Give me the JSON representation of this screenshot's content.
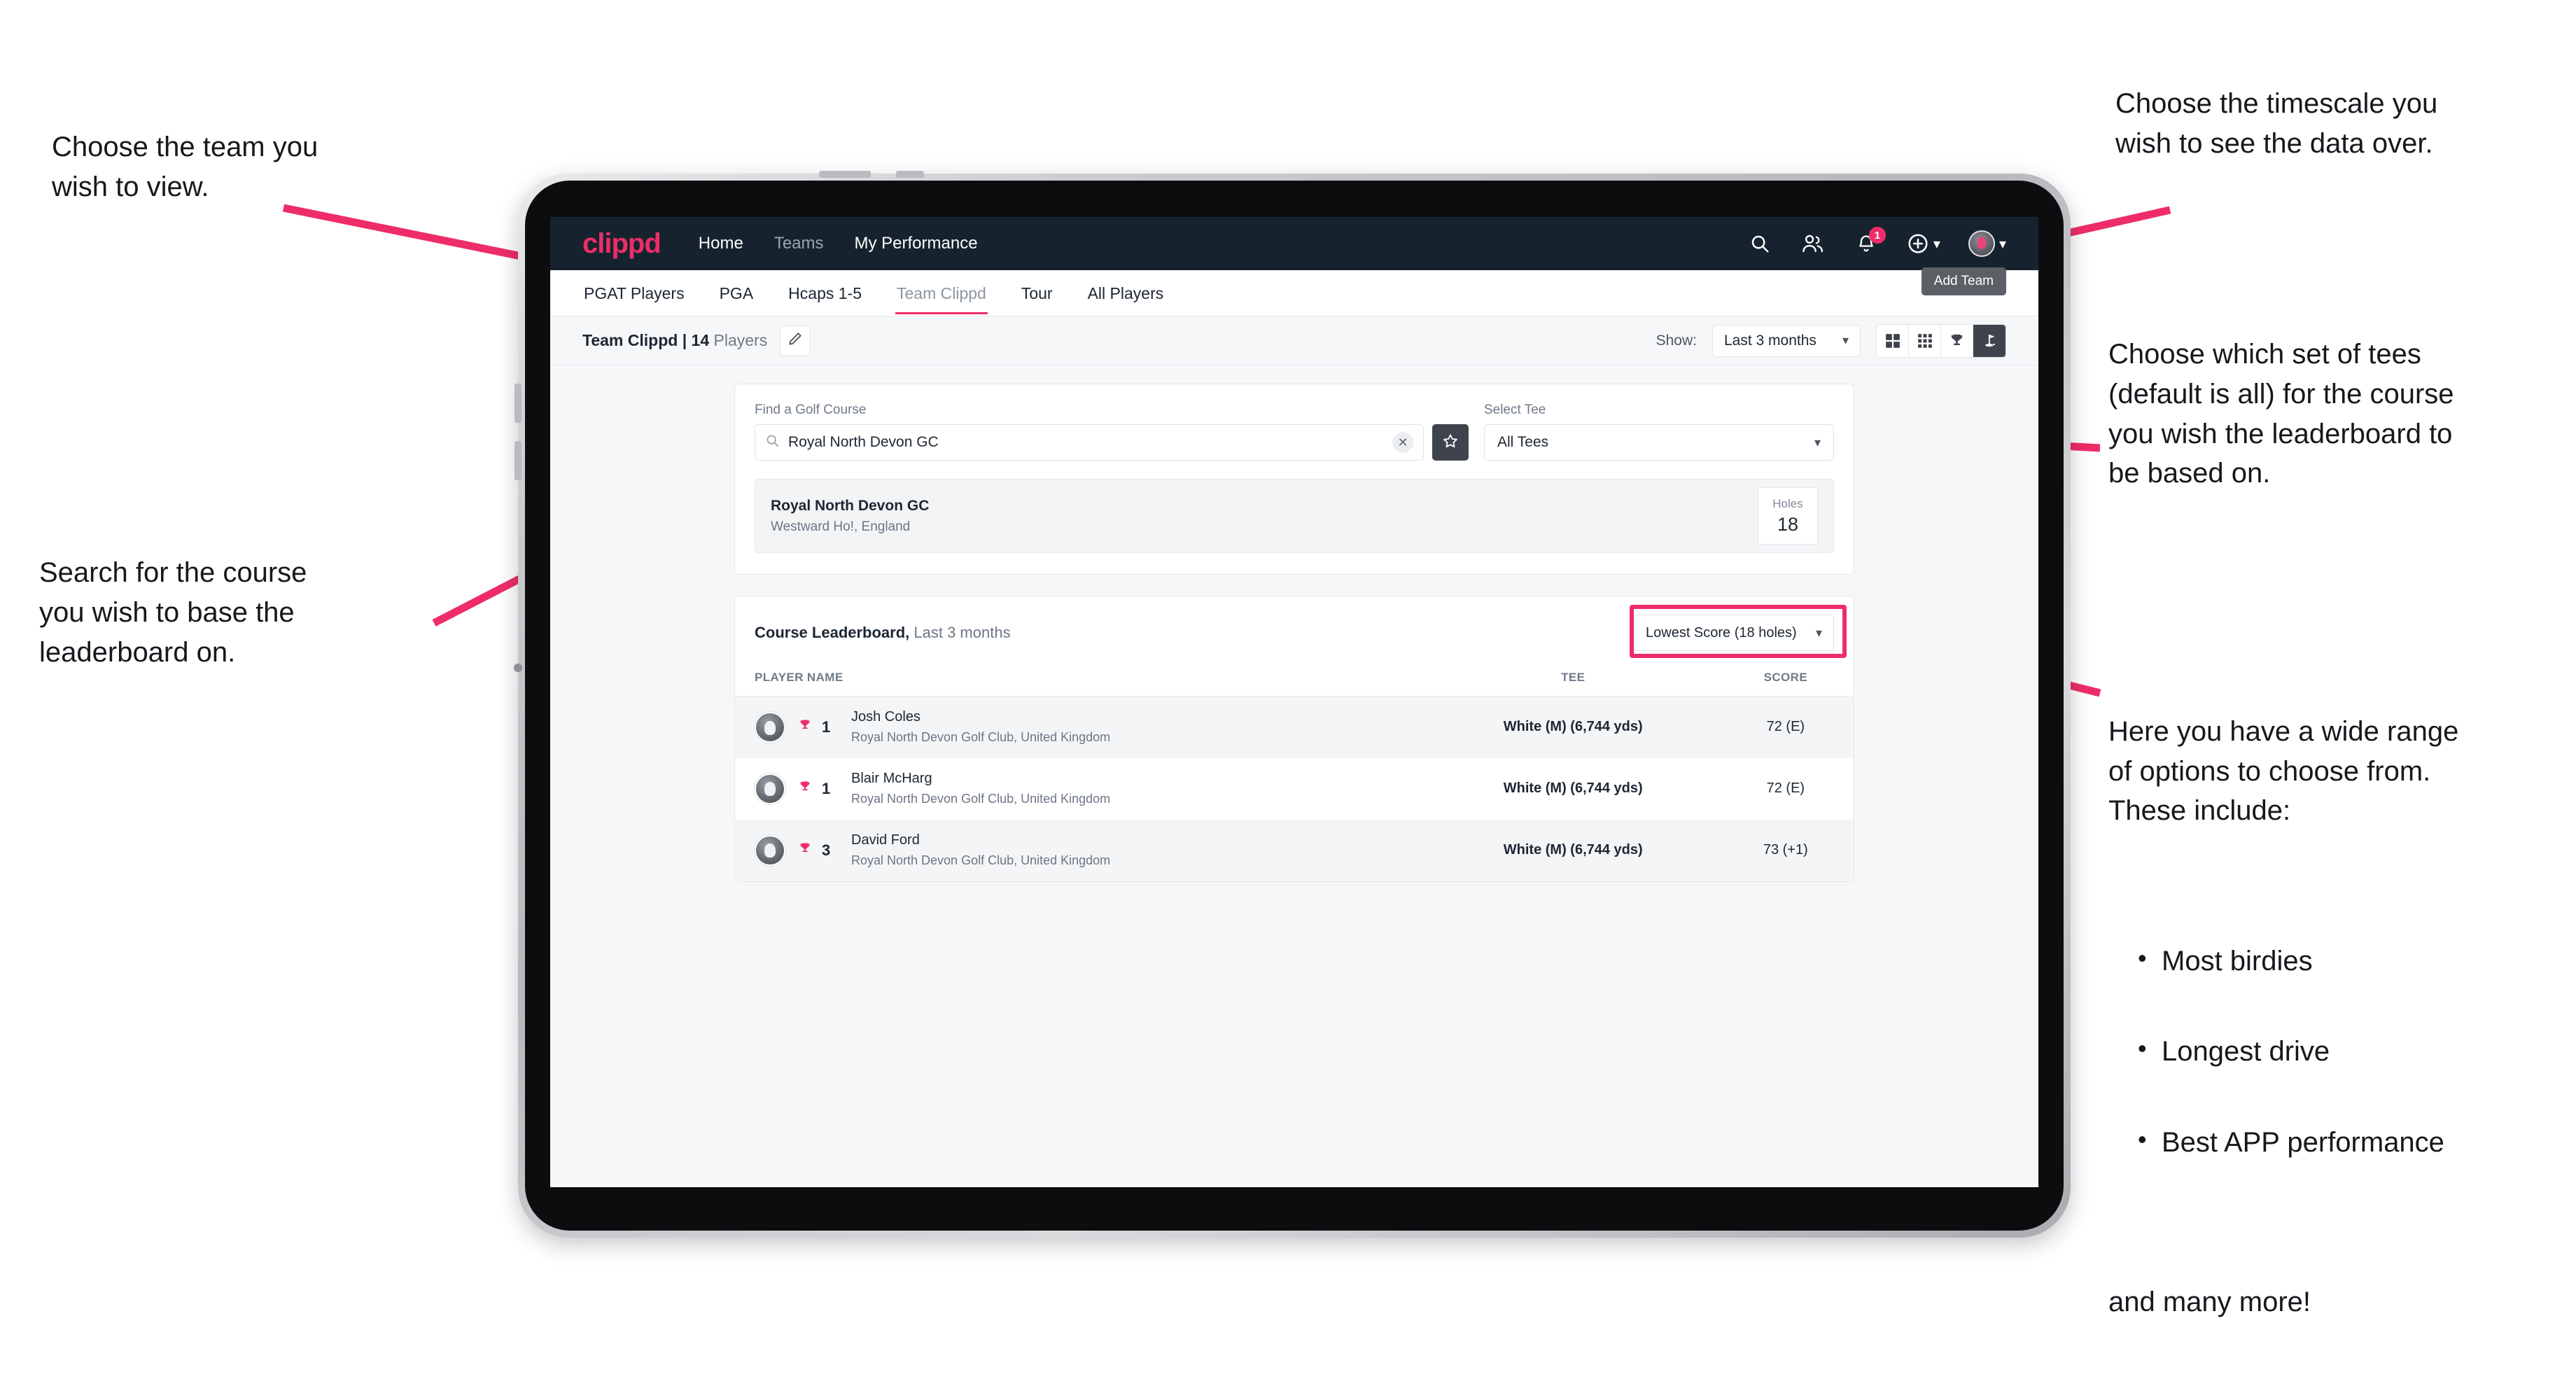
{
  "annotations": {
    "top_left": "Choose the team you\nwish to view.",
    "mid_left": "Search for the course\nyou wish to base the\nleaderboard on.",
    "top_right": "Choose the timescale you\nwish to see the data over.",
    "mid_right": "Choose which set of tees\n(default is all) for the course\nyou wish the leaderboard to\nbe based on.",
    "bottom_right_intro": "Here you have a wide range\nof options to choose from.\nThese include:",
    "bottom_right_bullets": [
      "Most birdies",
      "Longest drive",
      "Best APP performance"
    ],
    "bottom_right_tail": "and many more!"
  },
  "navbar": {
    "brand": "clippd",
    "links": [
      {
        "label": "Home",
        "muted": false
      },
      {
        "label": "Teams",
        "muted": true
      },
      {
        "label": "My Performance",
        "muted": false
      }
    ],
    "icons": [
      {
        "name": "search-icon"
      },
      {
        "name": "people-icon"
      },
      {
        "name": "bell-icon",
        "badge": "1"
      },
      {
        "name": "plus-circle-icon"
      },
      {
        "name": "avatar-icon"
      }
    ],
    "notification_count": "1"
  },
  "tabs": [
    {
      "label": "PGAT Players",
      "state": "normal"
    },
    {
      "label": "PGA",
      "state": "normal"
    },
    {
      "label": "Hcaps 1-5",
      "state": "normal"
    },
    {
      "label": "Team Clippd",
      "state": "active"
    },
    {
      "label": "Tour",
      "state": "normal"
    },
    {
      "label": "All Players",
      "state": "normal"
    }
  ],
  "tooltip": {
    "label": "Add Team"
  },
  "toolbar": {
    "team_name": "Team Clippd",
    "separator": " | ",
    "player_count": "14",
    "players_word": " Players",
    "edit_icon": "pencil-icon",
    "show_label": "Show:",
    "timescale_value": "Last 3 months",
    "views": [
      {
        "name": "grid-2x2-icon",
        "active": false
      },
      {
        "name": "grid-3x3-icon",
        "active": false
      },
      {
        "name": "trophy-icon",
        "active": false
      },
      {
        "name": "golf-flag-icon",
        "active": true
      }
    ]
  },
  "search": {
    "course_label": "Find a Golf Course",
    "course_value": "Royal North Devon GC",
    "course_placeholder": "Find a Golf Course",
    "clear_label": "✕",
    "star_icon": "star-icon",
    "tee_label": "Select Tee",
    "tee_value": "All Tees"
  },
  "course_result": {
    "name": "Royal North Devon GC",
    "location": "Westward Ho!, England",
    "holes_label": "Holes",
    "holes_value": "18"
  },
  "leaderboard": {
    "title": "Course Leaderboard,",
    "subtitle": " Last 3 months",
    "metric_value": "Lowest Score (18 holes)",
    "columns": [
      "PLAYER NAME",
      "TEE",
      "SCORE"
    ],
    "rows": [
      {
        "rank": "1",
        "name": "Josh Coles",
        "club": "Royal North Devon Golf Club, United Kingdom",
        "tee": "White (M) (6,744 yds)",
        "score": "72 (E)"
      },
      {
        "rank": "1",
        "name": "Blair McHarg",
        "club": "Royal North Devon Golf Club, United Kingdom",
        "tee": "White (M) (6,744 yds)",
        "score": "72 (E)"
      },
      {
        "rank": "3",
        "name": "David Ford",
        "club": "Royal North Devon Golf Club, United Kingdom",
        "tee": "White (M) (6,744 yds)",
        "score": "73 (+1)"
      }
    ]
  },
  "colors": {
    "accent_pink": "#ee2d68",
    "navbar_dark": "#16232e",
    "active_dark": "#3f444c",
    "page_bg": "#f6f7f9"
  }
}
